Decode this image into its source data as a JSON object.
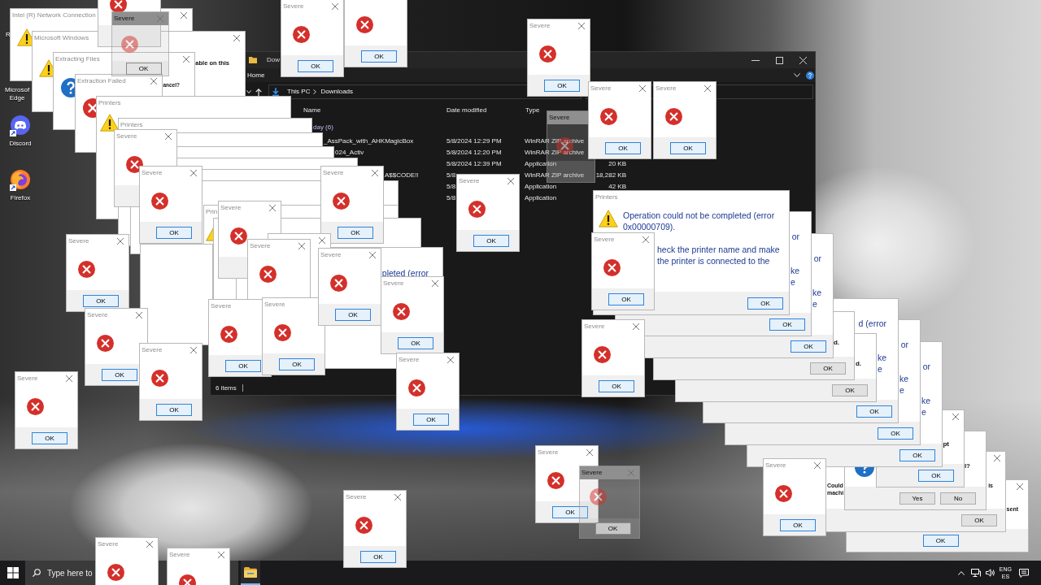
{
  "desktop": {
    "icons": [
      {
        "kind": "label",
        "label": "R"
      },
      {
        "kind": "label",
        "label": "Microsof Edge"
      },
      {
        "kind": "discord",
        "label": "Discord"
      },
      {
        "kind": "firefox",
        "label": "Firefox"
      }
    ]
  },
  "explorer": {
    "title": "Dow",
    "ribbon_tab": "Home",
    "breadcrumb": [
      "This PC",
      "Downloads"
    ],
    "columns": [
      "Name",
      "Date modified",
      "Type"
    ],
    "group": "day (6)",
    "rows": [
      {
        "name": "_AssPack_with_AHKMagicBox",
        "date": "5/8/2024 12:29 PM",
        "type": "WinRAR ZIP archive"
      },
      {
        "name": "024_Activ",
        "date": "5/8/2024 12:20 PM",
        "type": "WinRAR ZIP archive"
      },
      {
        "date": "5/8/2024 12:39 PM",
        "type": "Application",
        "size": "20 KB"
      },
      {
        "name": "A$$CODE!!",
        "date": "5/8",
        "type": "WinRAR ZIP archive",
        "size": "18,282 KB"
      },
      {
        "date": "5/8",
        "type": "Application",
        "size": "42 KB"
      },
      {
        "date": "5/8",
        "type": "Application"
      }
    ],
    "status": "6 items"
  },
  "dialogs": [
    {
      "kind": "warning",
      "title": "Intel (R) Network Connection"
    },
    {
      "kind": "faded",
      "title": "Severe",
      "buttons": [
        {
          "label": "OK",
          "focused": false
        }
      ]
    },
    {
      "kind": "warning",
      "title": "Microsoft Windows",
      "message": [
        "able on this"
      ]
    },
    {
      "kind": "question",
      "title": "Extracting Files",
      "message": [
        "ancel?"
      ]
    },
    {
      "kind": "error",
      "title": "Extraction Failed"
    },
    {
      "kind": "severe"
    },
    {
      "kind": "warning",
      "title": "Printers"
    },
    {
      "kind": "plain",
      "title": "Printers"
    },
    {
      "kind": "plain"
    },
    {
      "kind": "plain"
    },
    {
      "kind": "plain"
    },
    {
      "kind": "plain"
    },
    {
      "kind": "plain"
    },
    {
      "kind": "warning",
      "title": "Prin"
    },
    {
      "kind": "plain"
    },
    {
      "kind": "plain",
      "message": [
        "pleted (error"
      ]
    },
    {
      "kind": "plain"
    },
    {
      "kind": "severe",
      "title": "Severe",
      "buttons": [
        {
          "label": "OK",
          "focused": true
        }
      ]
    },
    {
      "kind": "severe",
      "buttons": [
        {
          "label": "OK",
          "focused": true
        }
      ]
    },
    {
      "kind": "severe",
      "title": "Severe",
      "buttons": [
        {
          "label": "OK",
          "focused": true
        }
      ]
    },
    {
      "kind": "faded",
      "title": "Severe"
    },
    {
      "kind": "severe",
      "title": "Severe",
      "buttons": [
        {
          "label": "OK",
          "focused": true
        }
      ]
    },
    {
      "kind": "severe",
      "title": "Severe",
      "buttons": [
        {
          "label": "OK",
          "focused": true
        }
      ]
    },
    {
      "kind": "severe",
      "title": "Severe"
    },
    {
      "kind": "severe",
      "title": "Severe",
      "buttons": [
        {
          "label": "OK",
          "focused": true
        }
      ]
    },
    {
      "kind": "severe",
      "title": "Severe",
      "buttons": [
        {
          "label": "OK",
          "focused": true
        }
      ]
    },
    {
      "kind": "severe",
      "title": "Severe",
      "buttons": [
        {
          "label": "OK",
          "focused": true
        }
      ]
    },
    {
      "kind": "severe",
      "title": "Severe"
    },
    {
      "kind": "severe"
    },
    {
      "kind": "severe",
      "title": "Severe",
      "buttons": [
        {
          "label": "OK",
          "focused": true
        }
      ]
    },
    {
      "kind": "severe",
      "title": "Severe"
    },
    {
      "kind": "severe",
      "title": "Severe",
      "buttons": [
        {
          "label": "OK",
          "focused": true
        }
      ]
    },
    {
      "kind": "severe",
      "title": "Severe",
      "buttons": [
        {
          "label": "OK",
          "focused": true
        }
      ]
    },
    {
      "kind": "severe",
      "title": "Severe",
      "buttons": [
        {
          "label": "OK",
          "focused": true
        }
      ]
    },
    {
      "kind": "severe",
      "title": "Severe",
      "buttons": [
        {
          "label": "OK",
          "focused": true
        }
      ]
    },
    {
      "kind": "severe",
      "title": "Severe",
      "buttons": [
        {
          "label": "OK",
          "focused": true
        }
      ]
    },
    {
      "kind": "severe",
      "title": "Severe",
      "buttons": [
        {
          "label": "OK",
          "focused": true
        }
      ]
    },
    {
      "kind": "severe",
      "title": "Severe",
      "buttons": [
        {
          "label": "OK",
          "focused": true
        }
      ]
    },
    {
      "kind": "severe",
      "title": "Severe",
      "buttons": [
        {
          "label": "OK",
          "focused": true
        }
      ]
    },
    {
      "kind": "plain",
      "message": [
        "sent"
      ],
      "buttons": [
        {
          "label": "OK",
          "focused": true
        }
      ]
    },
    {
      "kind": "plain",
      "message": [
        "Could\nmachi",
        "is"
      ],
      "buttons": [
        {
          "label": "OK",
          "focused": false
        }
      ]
    },
    {
      "kind": "question",
      "message": [
        "l?"
      ],
      "buttons": [
        {
          "label": "Yes",
          "focused": false
        },
        {
          "label": "No",
          "focused": false
        }
      ]
    },
    {
      "kind": "plain",
      "message": [
        "pt"
      ],
      "buttons": [
        {
          "label": "OK",
          "focused": true
        }
      ]
    },
    {
      "kind": "plain",
      "message": [
        "or",
        "ke\ne"
      ],
      "buttons": [
        {
          "label": "OK",
          "focused": true
        }
      ]
    },
    {
      "kind": "plain",
      "message": [
        "or",
        "ke\ne"
      ],
      "buttons": [
        {
          "label": "OK",
          "focused": true
        }
      ]
    },
    {
      "kind": "plain",
      "message": [
        "d (error",
        "ke\ne"
      ],
      "buttons": [
        {
          "label": "OK",
          "focused": true
        }
      ]
    },
    {
      "kind": "plain",
      "message": [
        "d."
      ],
      "buttons": [
        {
          "label": "OK",
          "focused": false
        }
      ]
    },
    {
      "kind": "plain",
      "message": [
        "d."
      ],
      "buttons": [
        {
          "label": "OK",
          "focused": false
        }
      ]
    },
    {
      "kind": "plain",
      "message": [
        "or",
        "ke\ne"
      ],
      "buttons": [
        {
          "label": "OK",
          "focused": true
        }
      ]
    },
    {
      "kind": "plain",
      "message": [
        "or",
        "ke\ne"
      ],
      "buttons": [
        {
          "label": "OK",
          "focused": true
        }
      ]
    },
    {
      "kind": "warning",
      "title": "Printers",
      "message": [
        "Operation could not be completed (error\n0x00000709).",
        "heck the printer name and make\nthe printer is connected to the"
      ],
      "buttons": [
        {
          "label": "OK",
          "focused": true
        }
      ]
    },
    {
      "kind": "severe",
      "title": "Severe",
      "buttons": [
        {
          "label": "OK",
          "focused": true
        }
      ]
    },
    {
      "kind": "severe",
      "title": "Severe",
      "buttons": [
        {
          "label": "OK",
          "focused": true
        }
      ]
    },
    {
      "kind": "severe",
      "title": "Severe",
      "buttons": [
        {
          "label": "OK",
          "focused": true
        }
      ]
    },
    {
      "kind": "severe",
      "title": "Severe",
      "buttons": [
        {
          "label": "OK",
          "focused": true
        }
      ]
    },
    {
      "kind": "faded",
      "title": "Severe",
      "buttons": [
        {
          "label": "OK",
          "focused": false
        }
      ]
    },
    {
      "kind": "severe",
      "title": "Severe",
      "buttons": [
        {
          "label": "OK",
          "focused": true
        }
      ]
    },
    {
      "kind": "severe",
      "title": "Severe"
    },
    {
      "kind": "severe",
      "title": "Severe"
    }
  ],
  "taskbar": {
    "search": {
      "placeholder": "Type here to"
    },
    "apps": [
      {
        "kind": "folder",
        "running": true
      }
    ],
    "language": "ENG",
    "keyboard": "ES"
  }
}
